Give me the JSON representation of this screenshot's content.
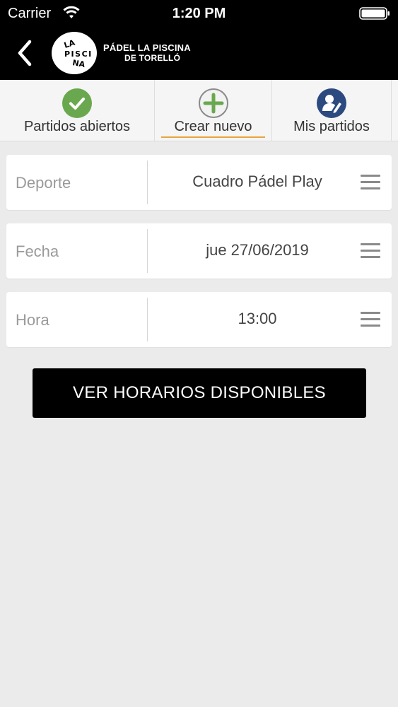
{
  "status_bar": {
    "carrier": "Carrier",
    "time": "1:20 PM"
  },
  "header": {
    "logo_text": "LA PISCINA",
    "brand_line1": "PÁDEL LA PISCINA",
    "brand_line2": "DE TORELLÓ"
  },
  "tabs": [
    {
      "label": "Partidos abiertos",
      "icon": "check-circle-icon",
      "color": "#6aa84f"
    },
    {
      "label": "Crear nuevo",
      "icon": "plus-circle-icon",
      "color": "#6aa84f",
      "active": true
    },
    {
      "label": "Mis partidos",
      "icon": "user-edit-icon",
      "color": "#2c4a80"
    }
  ],
  "form": {
    "rows": [
      {
        "label": "Deporte",
        "value": "Cuadro Pádel Play"
      },
      {
        "label": "Fecha",
        "value": "jue 27/06/2019"
      },
      {
        "label": "Hora",
        "value": "13:00"
      }
    ]
  },
  "action": {
    "label": "VER HORARIOS DISPONIBLES"
  },
  "colors": {
    "header_bg": "#000000",
    "active_underline": "#e8a43a",
    "background": "#ebebeb"
  }
}
